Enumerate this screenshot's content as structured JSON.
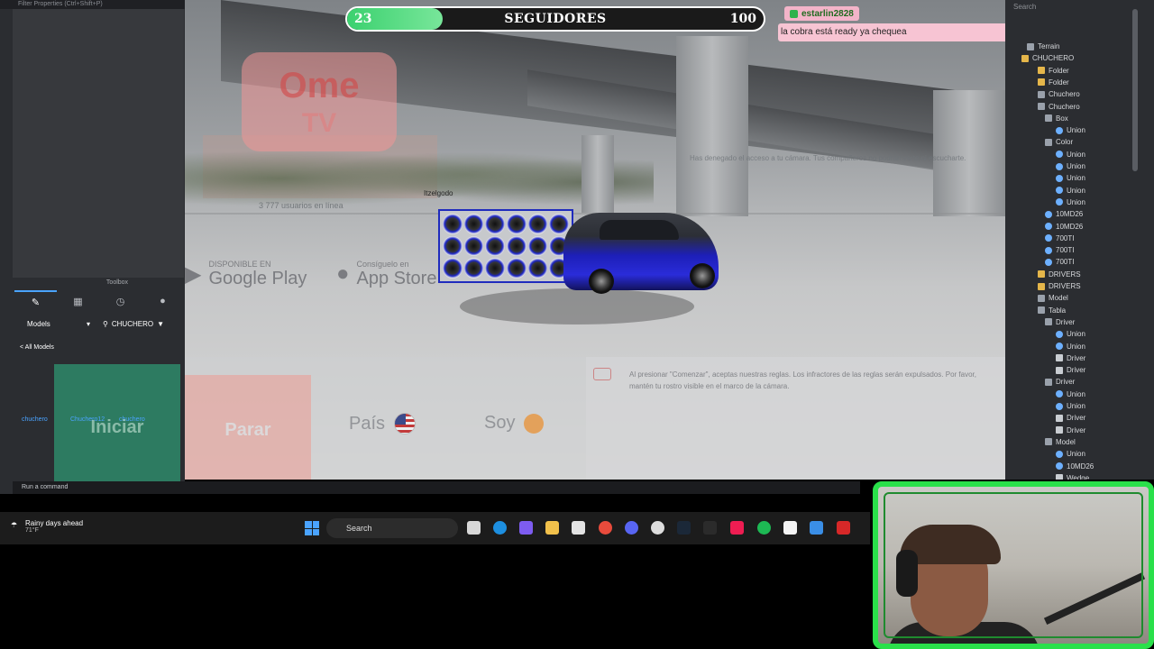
{
  "studio": {
    "filter_label": "Filter Properties (Ctrl+Shift+P)",
    "toolbox": {
      "title": "Toolbox",
      "category": "Models",
      "search_value": "CHUCHERO",
      "back_label": "< All Models",
      "items": [
        "chuchero",
        "Chuchero12",
        "chuchero"
      ]
    },
    "command_bar": "Run a command"
  },
  "stream": {
    "followers": {
      "current": "23",
      "label": "SEGUIDORES",
      "goal": "100",
      "progress": 0.23
    },
    "chat": {
      "user": "estarlin2828",
      "message": "la cobra está ready ya chequea"
    }
  },
  "ometv": {
    "logo_line1": "Ome",
    "logo_line2": "TV",
    "google_play_small": "DISPONIBLE EN",
    "google_play_big": "Google Play",
    "app_store_small": "Consíguelo en",
    "app_store_big": "App Store",
    "online_count": "3 777 usuarios en línea",
    "denied_notice": "Has denegado el acceso a tu cámara. Tus compañeros no podrán verte ni escucharte.",
    "player_name": "Itzelgodo",
    "btn_start": "Iniciar",
    "btn_stop": "Parar",
    "country_label": "País",
    "self_label": "Soy",
    "rules_text": "Al presionar \"Comenzar\", aceptas nuestras reglas. Los infractores de las reglas serán expulsados. Por favor, mantén tu rostro visible en el marco de la cámara."
  },
  "explorer": {
    "search_placeholder": "Search",
    "items": [
      "Terrain",
      "CHUCHERO",
      "Folder",
      "Folder",
      "Chuchero",
      "Chuchero",
      "Box",
      "Union",
      "Color",
      "Union",
      "Union",
      "Union",
      "Union",
      "Union",
      "10MD26",
      "10MD26",
      "700TI",
      "700TI",
      "700TI",
      "DRIVERS",
      "DRIVERS",
      "Model",
      "Tabla",
      "Driver",
      "Union",
      "Union",
      "Driver",
      "Driver",
      "Driver",
      "Union",
      "Union",
      "Driver",
      "Driver",
      "Model",
      "Union",
      "10MD26",
      "Wedge"
    ]
  },
  "taskbar": {
    "weather_label": "Rainy days ahead",
    "weather_temp": "71°F",
    "search_label": "Search"
  },
  "colors": {
    "followers_fill": "#3bd16f",
    "chat_bg": "#f7c4d3",
    "webcam_border": "#2ae04a",
    "car_blue": "#1d1fb8"
  }
}
